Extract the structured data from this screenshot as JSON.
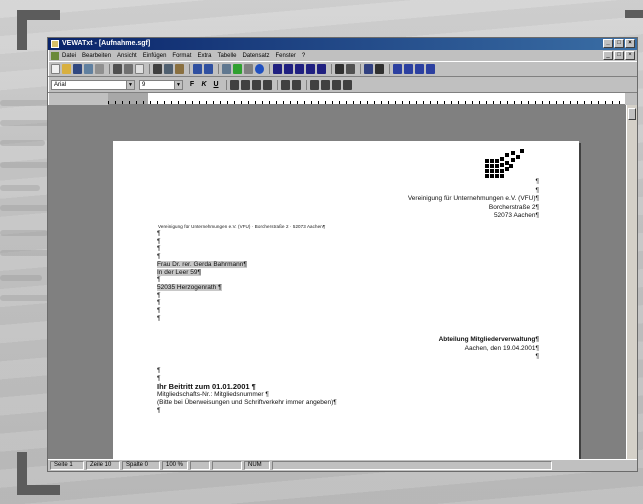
{
  "window": {
    "title": "VEWATxt - [Aufnahme.sgf]"
  },
  "menu": {
    "items": [
      "Datei",
      "Bearbeiten",
      "Ansicht",
      "Einfügen",
      "Format",
      "Extra",
      "Tabelle",
      "Datensatz",
      "Fenster",
      "?"
    ]
  },
  "format_bar": {
    "font": "Arial",
    "size": "9",
    "buttons": [
      "F",
      "K",
      "U"
    ]
  },
  "document": {
    "sender": {
      "pilcrow_1": "¶",
      "pilcrow_2": "¶",
      "org": "Vereinigung für Unternehmungen e.V. (VFU)¶",
      "street": "Borcherstraße 2¶",
      "city": "52073 Aachen¶"
    },
    "return_line": "Vereinigung für Unternehmungen e.V. (VFU) · Borcherstraße 2 · 52073 Aachen¶",
    "recipient": {
      "p1": "¶",
      "p2": "¶",
      "p3": "¶",
      "p4": "¶",
      "name": "Frau Dr. rer. Gerda Bahrmann¶",
      "street": "In der Leer 59¶",
      "p5": "¶",
      "city": "52035 Herzogenrath ¶",
      "p6": "¶",
      "p7": "¶",
      "p8": "¶",
      "p9": "¶"
    },
    "department": {
      "name": "Abteilung Mitgliederverwaltung¶",
      "date": "Aachen, den 19.04.2001¶",
      "pilcrow": "¶"
    },
    "body": {
      "p1": "¶",
      "p2": "¶",
      "subject": "Ihr Beitritt zum 01.01.2001 ¶",
      "member_no": "Mitgliedschafts-Nr.: Mitgliedsnummer ¶",
      "note": "(Bitte bei Überweisungen und Schriftverkehr immer angeben)¶",
      "p3": "¶"
    }
  },
  "status": {
    "page": "Seite  1",
    "line": "Zeile  10",
    "column": "Spalte  0",
    "zoom": "100 %",
    "num": "NUM"
  }
}
